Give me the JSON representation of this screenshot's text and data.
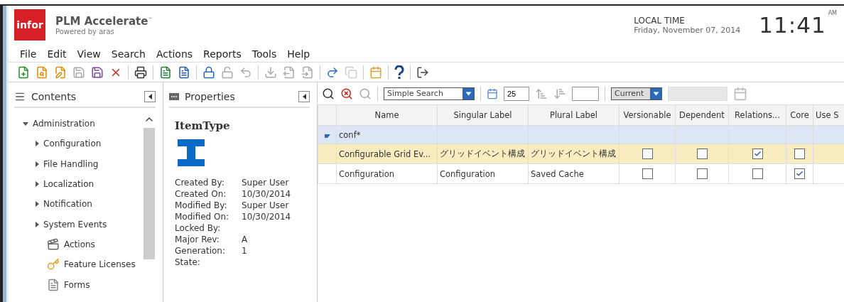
{
  "header": {
    "logo": "infor",
    "product": "PLM Accelerate",
    "trademark": "™",
    "tagline": "Powered by aras",
    "time_label": "LOCAL TIME",
    "date": "Friday, November 07, 2014",
    "time": "11:41",
    "meridiem": "AM"
  },
  "menu": [
    "File",
    "Edit",
    "View",
    "Search",
    "Actions",
    "Reports",
    "Tools",
    "Help"
  ],
  "contents": {
    "title": "Contents",
    "tree": [
      {
        "label": "Administration",
        "kind": "group",
        "expanded": true,
        "children": [
          {
            "label": "Configuration",
            "kind": "group",
            "expanded": false
          },
          {
            "label": "File Handling",
            "kind": "group",
            "expanded": false
          },
          {
            "label": "Localization",
            "kind": "group",
            "expanded": false
          },
          {
            "label": "Notification",
            "kind": "group",
            "expanded": false
          },
          {
            "label": "System Events",
            "kind": "group",
            "expanded": false
          },
          {
            "label": "Actions",
            "kind": "item"
          },
          {
            "label": "Feature Licenses",
            "kind": "item"
          },
          {
            "label": "Forms",
            "kind": "item"
          }
        ]
      }
    ]
  },
  "properties": {
    "title": "Properties",
    "item_title": "ItemType",
    "fields": [
      {
        "label": "Created By:",
        "value": "Super User"
      },
      {
        "label": "Created On:",
        "value": "10/30/2014"
      },
      {
        "label": "Modified By:",
        "value": "Super User"
      },
      {
        "label": "Modified On:",
        "value": "10/30/2014"
      },
      {
        "label": "Locked By:"
      },
      {
        "label": "Major Rev:",
        "value": "A"
      },
      {
        "label": "Generation:",
        "value": "1"
      },
      {
        "label": "State:"
      }
    ]
  },
  "search": {
    "mode": "Simple Search",
    "page_size": "25",
    "version": "Current"
  },
  "grid": {
    "columns": [
      "Name",
      "Singular Label",
      "Plural Label",
      "Versionable",
      "Dependent",
      "Relations...",
      "Core",
      "Use S"
    ],
    "rows": [
      {
        "kind": "filter",
        "expanded": true,
        "cells": [
          "conf*"
        ]
      },
      {
        "kind": "data",
        "selected": true,
        "cells": [
          "Configurable Grid Ev...",
          "グリッドイベント構成",
          "グリッドイベント構成"
        ],
        "checks": [
          false,
          false,
          true,
          false
        ]
      },
      {
        "kind": "data",
        "selected": false,
        "cells": [
          "Configuration",
          "Configuration",
          "Saved Cache"
        ],
        "checks": [
          false,
          false,
          false,
          true
        ]
      }
    ]
  }
}
